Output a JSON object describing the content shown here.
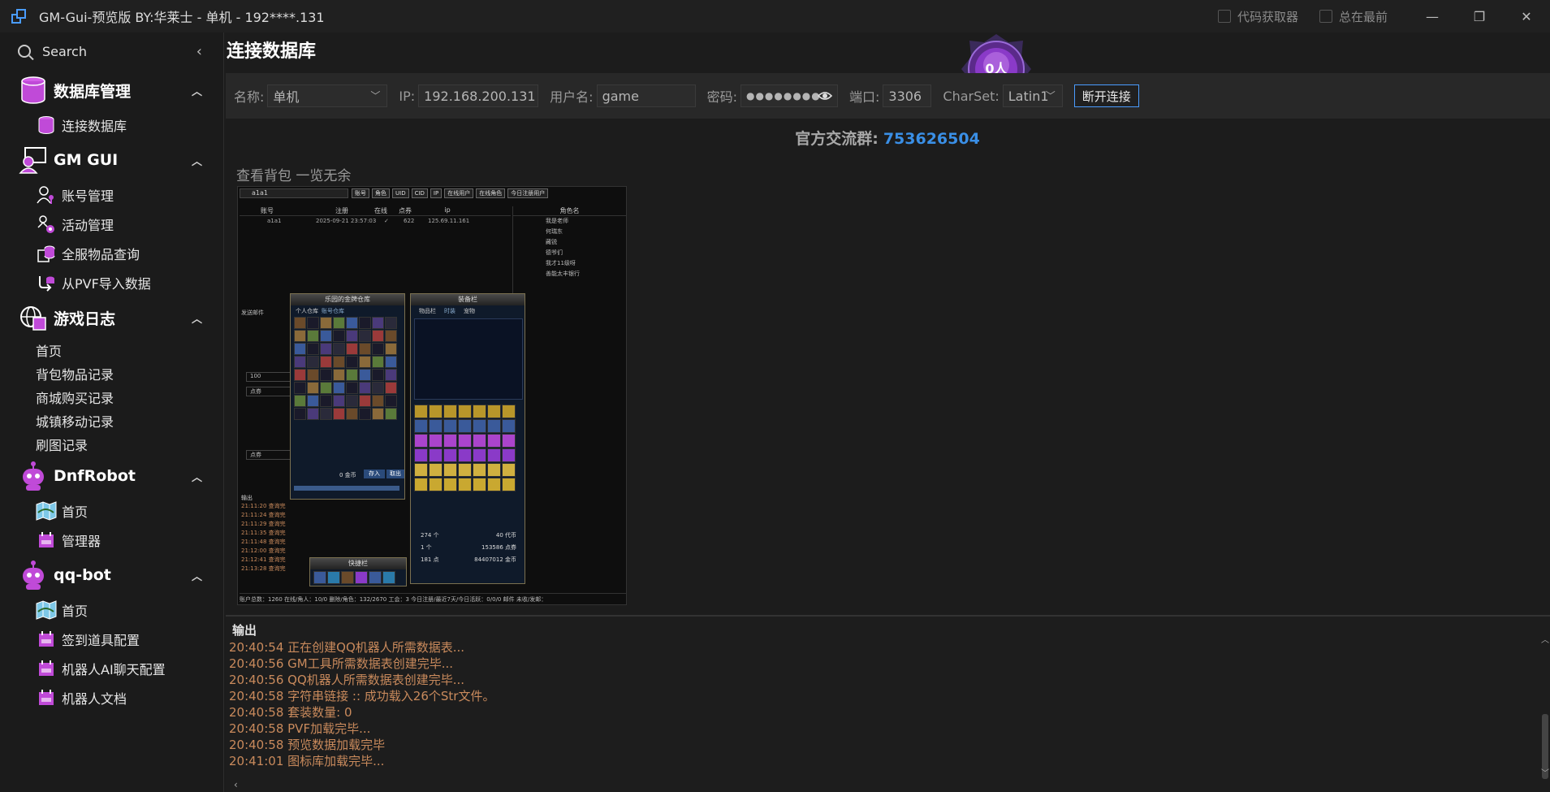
{
  "titlebar": {
    "title": "GM-Gui-预览版 BY:华莱士 - 单机 - 192****.131",
    "checkbox_code": "代码获取器",
    "checkbox_top": "总在最前",
    "min_glyph": "—",
    "max_glyph": "❐",
    "close_glyph": "✕"
  },
  "sidebar": {
    "search_label": "Search",
    "collapse_glyph": "‹",
    "groups": [
      {
        "label": "数据库管理",
        "icon": "database-icon",
        "items": [
          {
            "label": "连接数据库",
            "icon": "database-icon"
          }
        ]
      },
      {
        "label": "GM GUI",
        "icon": "monitor-user-icon",
        "items": [
          {
            "label": "账号管理",
            "icon": "user-key-icon"
          },
          {
            "label": "活动管理",
            "icon": "activity-icon"
          },
          {
            "label": "全服物品查询",
            "icon": "items-icon"
          },
          {
            "label": "从PVF导入数据",
            "icon": "import-icon"
          }
        ]
      },
      {
        "label": "游戏日志",
        "icon": "globe-log-icon",
        "items": [
          {
            "label": "首页"
          },
          {
            "label": "背包物品记录"
          },
          {
            "label": "商城购买记录"
          },
          {
            "label": "城镇移动记录"
          },
          {
            "label": "刷图记录"
          }
        ]
      },
      {
        "label": "DnfRobot",
        "icon": "robot-icon",
        "items": [
          {
            "label": "首页",
            "icon": "map-icon"
          },
          {
            "label": "管理器",
            "icon": "calendar-icon"
          }
        ]
      },
      {
        "label": "qq-bot",
        "icon": "robot-icon",
        "items": [
          {
            "label": "首页",
            "icon": "map-icon"
          },
          {
            "label": "签到道具配置",
            "icon": "calendar-icon"
          },
          {
            "label": "机器人AI聊天配置",
            "icon": "calendar-icon"
          },
          {
            "label": "机器人文档",
            "icon": "calendar-icon"
          }
        ]
      }
    ]
  },
  "main": {
    "page_title": "连接数据库",
    "logo_text": "0人",
    "conn": {
      "name_label": "名称:",
      "name_value": "单机",
      "ip_label": "IP:",
      "ip_value": "192.168.200.131",
      "user_label": "用户名:",
      "user_value": "game",
      "pwd_label": "密码:",
      "pwd_value": "●●●●●●●●",
      "port_label": "端口:",
      "port_value": "3306",
      "charset_label": "CharSet:",
      "charset_value": "Latin1",
      "disconnect_label": "断开连接"
    },
    "qq_label": "官方交流群:",
    "qq_value": "753626504",
    "preview_caption": "查看背包 一览无余",
    "preview": {
      "search_value": "a1a1",
      "buttons": [
        "账号",
        "角色",
        "UID",
        "CID",
        "IP",
        "在线用户",
        "在线角色",
        "今日注册用户"
      ],
      "headers": [
        "账号",
        "注册",
        "在线",
        "点券",
        "ip"
      ],
      "row": [
        "a1a1",
        "2025-09-21 23:57:03",
        "✓",
        "622",
        "125.69.11.161"
      ],
      "role_header": "角色名",
      "roles": [
        "我是老师",
        "何瑞东",
        "藏锐",
        "德爷们",
        "我才11级呀",
        "善能太丰银行"
      ],
      "win1_title": "乐园的金牌仓库",
      "win2_title": "装备栏",
      "win3_title": "快捷栏",
      "tab_personal": "个人仓库",
      "tab_account": "账号仓库",
      "gold": "0 金币",
      "deposit": "存入",
      "withdraw": "取出",
      "equip_tabs": [
        "物品栏",
        "时装",
        "宠物"
      ],
      "stat1": "274 个",
      "stat2": "40 代币",
      "stat3": "1 个",
      "stat4": "153586 点券",
      "stat5": "181 点",
      "stat6": "84407012 金币",
      "footer": "账户总数：1260   在线/角人：10/0   删除/角色：132/2670   工会：3   今日注册/最近7天/今日活跃：0/0/0   邮件 未收/发邮：",
      "send_mail": "发送邮件",
      "value_100": "100",
      "point": "点券",
      "out_label": "输出",
      "log_lines": [
        "21:11:20 查询完",
        "21:11:24 查询完",
        "21:11:29 查询完",
        "21:11:35 查询完",
        "21:11:48 查询完",
        "21:12:00 查询完",
        "21:12:41 查询完",
        "21:13:28 查询完"
      ]
    }
  },
  "output": {
    "title": "输出",
    "lines": [
      "20:40:54 正在创建QQ机器人所需数据表...",
      "20:40:56 GM工具所需数据表创建完毕...",
      "20:40:56 QQ机器人所需数据表创建完毕...",
      "20:40:58 字符串链接 :: 成功载入26个Str文件。",
      "20:40:58 套装数量:  0",
      "20:40:58 PVF加载完毕...",
      "20:40:58 预览数据加载完毕",
      "20:41:01 图标库加载完毕..."
    ]
  },
  "colors": {
    "accent": "#4a9cff",
    "qq_number": "#3a8fe6",
    "log_text": "#c98a5c",
    "icon_purple": "#c04ad8"
  }
}
